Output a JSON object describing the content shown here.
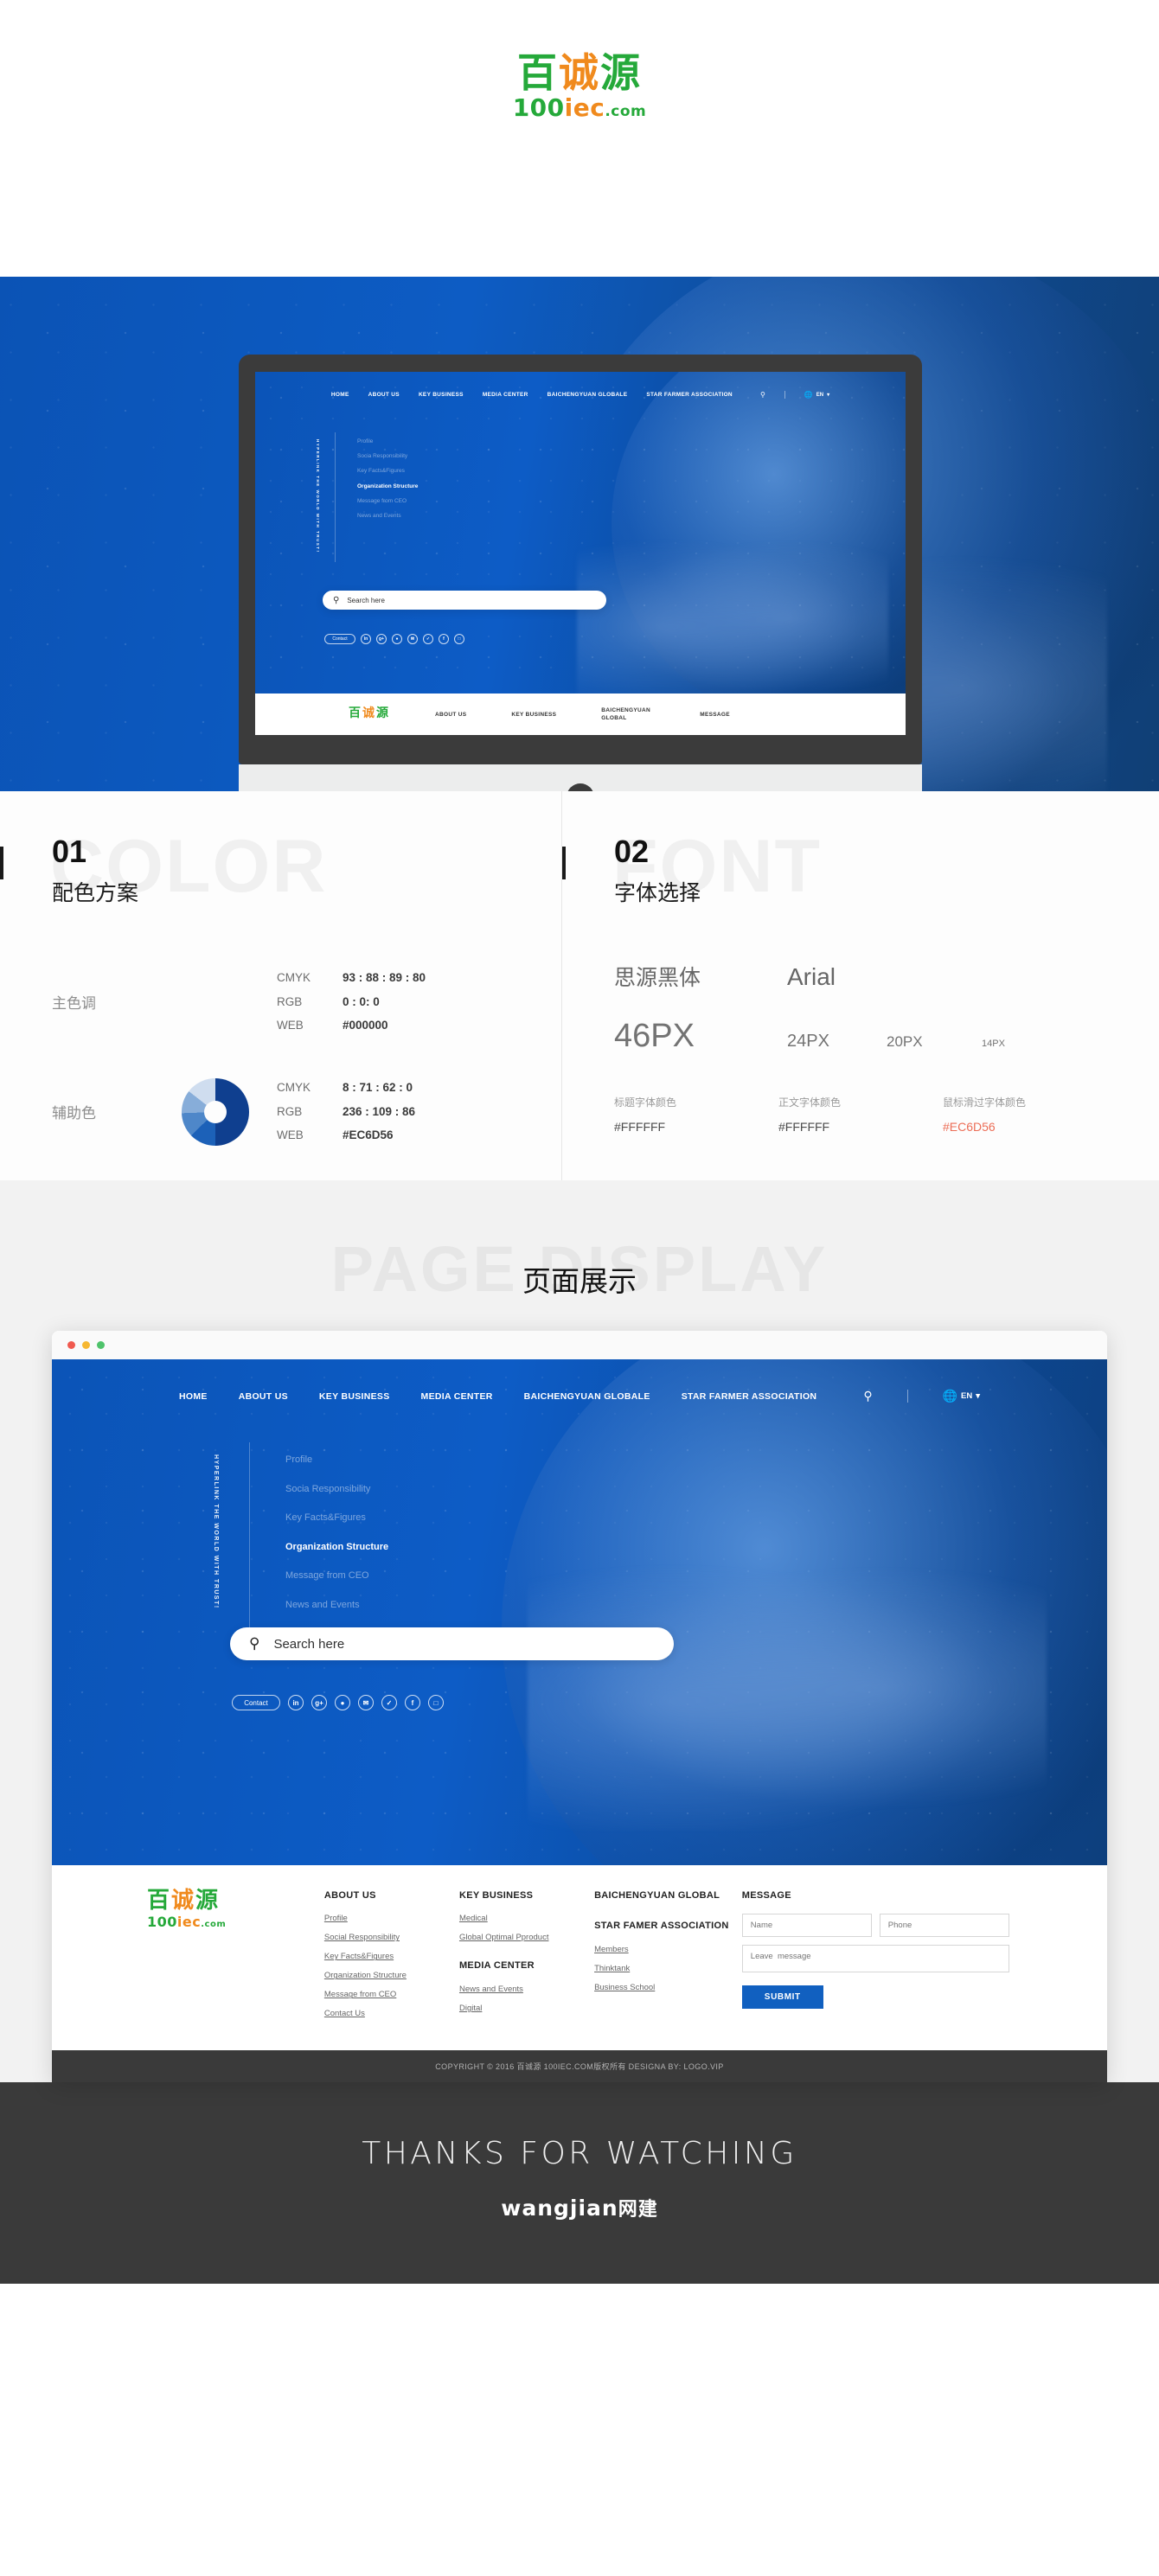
{
  "brand": {
    "cn_chars": [
      "百",
      "诚",
      "源"
    ],
    "cn_full": "百诚源",
    "en_part1": "100",
    "en_part2": "iec",
    "en_suffix": ".com",
    "green": "#25a93a",
    "orange": "#f08a1d"
  },
  "site": {
    "nav": [
      "HOME",
      "ABOUT US",
      "KEY BUSINESS",
      "MEDIA CENTER",
      "BAICHENGYUAN GLOBALE",
      "STAR FARMER ASSOCIATION"
    ],
    "search_icon": "search-icon",
    "globe_icon": "globe-icon",
    "language": "EN",
    "language_caret": "▾",
    "tagline_vertical": "HYPERLINK THE WORLD WITH TRUST!",
    "side_menu": [
      {
        "label": "Profile",
        "active": false
      },
      {
        "label": "Socia Responsibility",
        "active": false
      },
      {
        "label": "Key Facts&Figures",
        "active": false
      },
      {
        "label": "Organization Structure",
        "active": true
      },
      {
        "label": "Message from CEO",
        "active": false
      },
      {
        "label": "News and Events",
        "active": false
      }
    ],
    "search_placeholder": "Search here",
    "contact_label": "Contact",
    "social": [
      {
        "name": "linkedin-icon",
        "glyph": "in"
      },
      {
        "name": "googleplus-icon",
        "glyph": "g+"
      },
      {
        "name": "weibo-icon",
        "glyph": "●"
      },
      {
        "name": "email-icon",
        "glyph": "✉"
      },
      {
        "name": "twitter-icon",
        "glyph": "✓"
      },
      {
        "name": "facebook-icon",
        "glyph": "f"
      },
      {
        "name": "instagram-icon",
        "glyph": "□"
      }
    ],
    "bottom_bar": [
      "ABOUT US",
      "KEY BUSINESS",
      "BAICHENGYUAN GLOBAL",
      "MESSAGE"
    ]
  },
  "panels": [
    {
      "number": "01",
      "ghost": "COLOR",
      "subtitle": "配色方案",
      "swatches": [
        {
          "label": "主色调",
          "vis": "none",
          "cmyk_key": "CMYK",
          "cmyk_value": "93 : 88 : 89 : 80",
          "rgb_key": "RGB",
          "rgb_value": "0 : 0: 0",
          "web_key": "WEB",
          "web_value": "#000000"
        },
        {
          "label": "辅助色",
          "vis": "donut",
          "cmyk_key": "CMYK",
          "cmyk_value": "8 : 71 : 62 : 0",
          "rgb_key": "RGB",
          "rgb_value": "236 : 109 : 86",
          "web_key": "WEB",
          "web_value": "#EC6D56"
        }
      ]
    },
    {
      "number": "02",
      "ghost": "FONT",
      "subtitle": "字体选择",
      "font_names": {
        "cn": "思源黑体",
        "en": "Arial"
      },
      "font_sizes": [
        "46PX",
        "24PX",
        "20PX",
        "14PX"
      ],
      "font_colors": [
        {
          "caption": "标题字体颜色",
          "value": "#FFFFFF",
          "accent": false
        },
        {
          "caption": "正文字体颜色",
          "value": "#FFFFFF",
          "accent": false
        },
        {
          "caption": "鼠标滑过字体颜色",
          "value": "#EC6D56",
          "accent": true
        }
      ]
    }
  ],
  "display": {
    "ghost": "PAGE DISPLAY",
    "title": "页面展示",
    "browser_dots": [
      "#f05a4f",
      "#f6b731",
      "#4fc36b"
    ]
  },
  "footer": {
    "columns": [
      {
        "heading": "ABOUT US",
        "links": [
          "Profile",
          "Social Responsibility",
          "Key Facts&Figures",
          "Organization Structure",
          "Message from CEO",
          "Contact Us"
        ]
      },
      {
        "heading": "KEY BUSINESS",
        "links": [
          "Medical",
          "Global Optimal Pproduct"
        ],
        "heading2": "MEDIA CENTER",
        "links2": [
          "News and Events",
          "Digital"
        ]
      },
      {
        "heading": "BAICHENGYUAN GLOBAL",
        "links": [],
        "heading2": "STAR FAMER ASSOCIATION",
        "links2": [
          "Members",
          "Thinktank",
          "Business School"
        ]
      }
    ],
    "form": {
      "heading": "MESSAGE",
      "name_placeholder": "Name",
      "phone_placeholder": "Phone",
      "message_placeholder": "Leave  message",
      "submit_label": "SUBMIT",
      "submit_color": "#1160c0"
    },
    "copyright": "COPYRIGHT © 2016 百诚源 100IEC.COM版权所有    DESIGNA  BY:  LOGO.VIP"
  },
  "thanks": {
    "title": "THANKS FOR WATCHING",
    "logo_en": "wangjian",
    "logo_cn": "网建"
  }
}
